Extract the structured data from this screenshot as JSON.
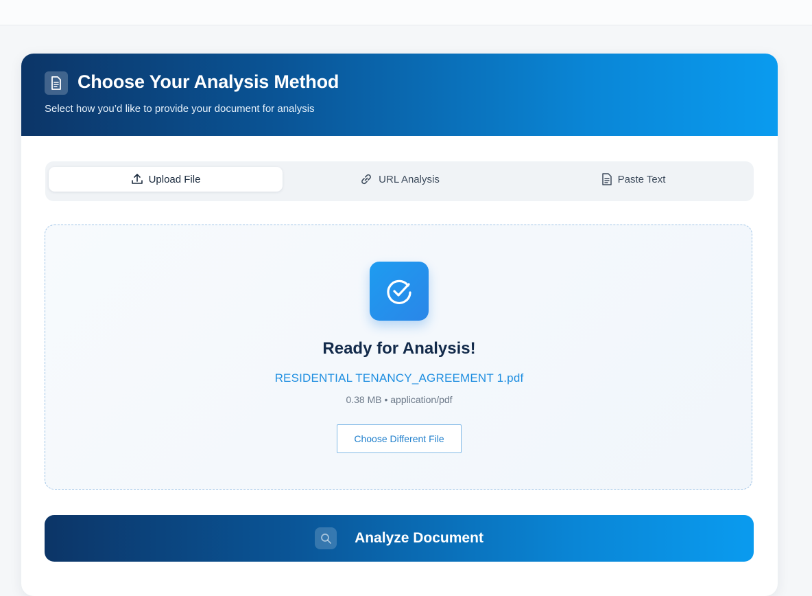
{
  "card": {
    "title": "Choose Your Analysis Method",
    "subtitle": "Select how you’d like to provide your document for analysis",
    "header_icon": "document-icon"
  },
  "tabs": [
    {
      "label": "Upload File",
      "icon": "upload-icon",
      "active": true
    },
    {
      "label": "URL Analysis",
      "icon": "link-icon",
      "active": false
    },
    {
      "label": "Paste Text",
      "icon": "document-icon",
      "active": false
    }
  ],
  "upload": {
    "status_icon": "check-circle-icon",
    "status_title": "Ready for Analysis!",
    "file_name": "RESIDENTIAL TENANCY_AGREEMENT 1.pdf",
    "file_meta": "0.38 MB • application/pdf",
    "change_button_label": "Choose Different File"
  },
  "analyze": {
    "label": "Analyze Document",
    "icon": "search-icon"
  },
  "colors": {
    "header_gradient_start": "#0c3567",
    "header_gradient_end": "#0a9bef",
    "accent": "#1e8ee0",
    "title_text": "#122a4a"
  }
}
